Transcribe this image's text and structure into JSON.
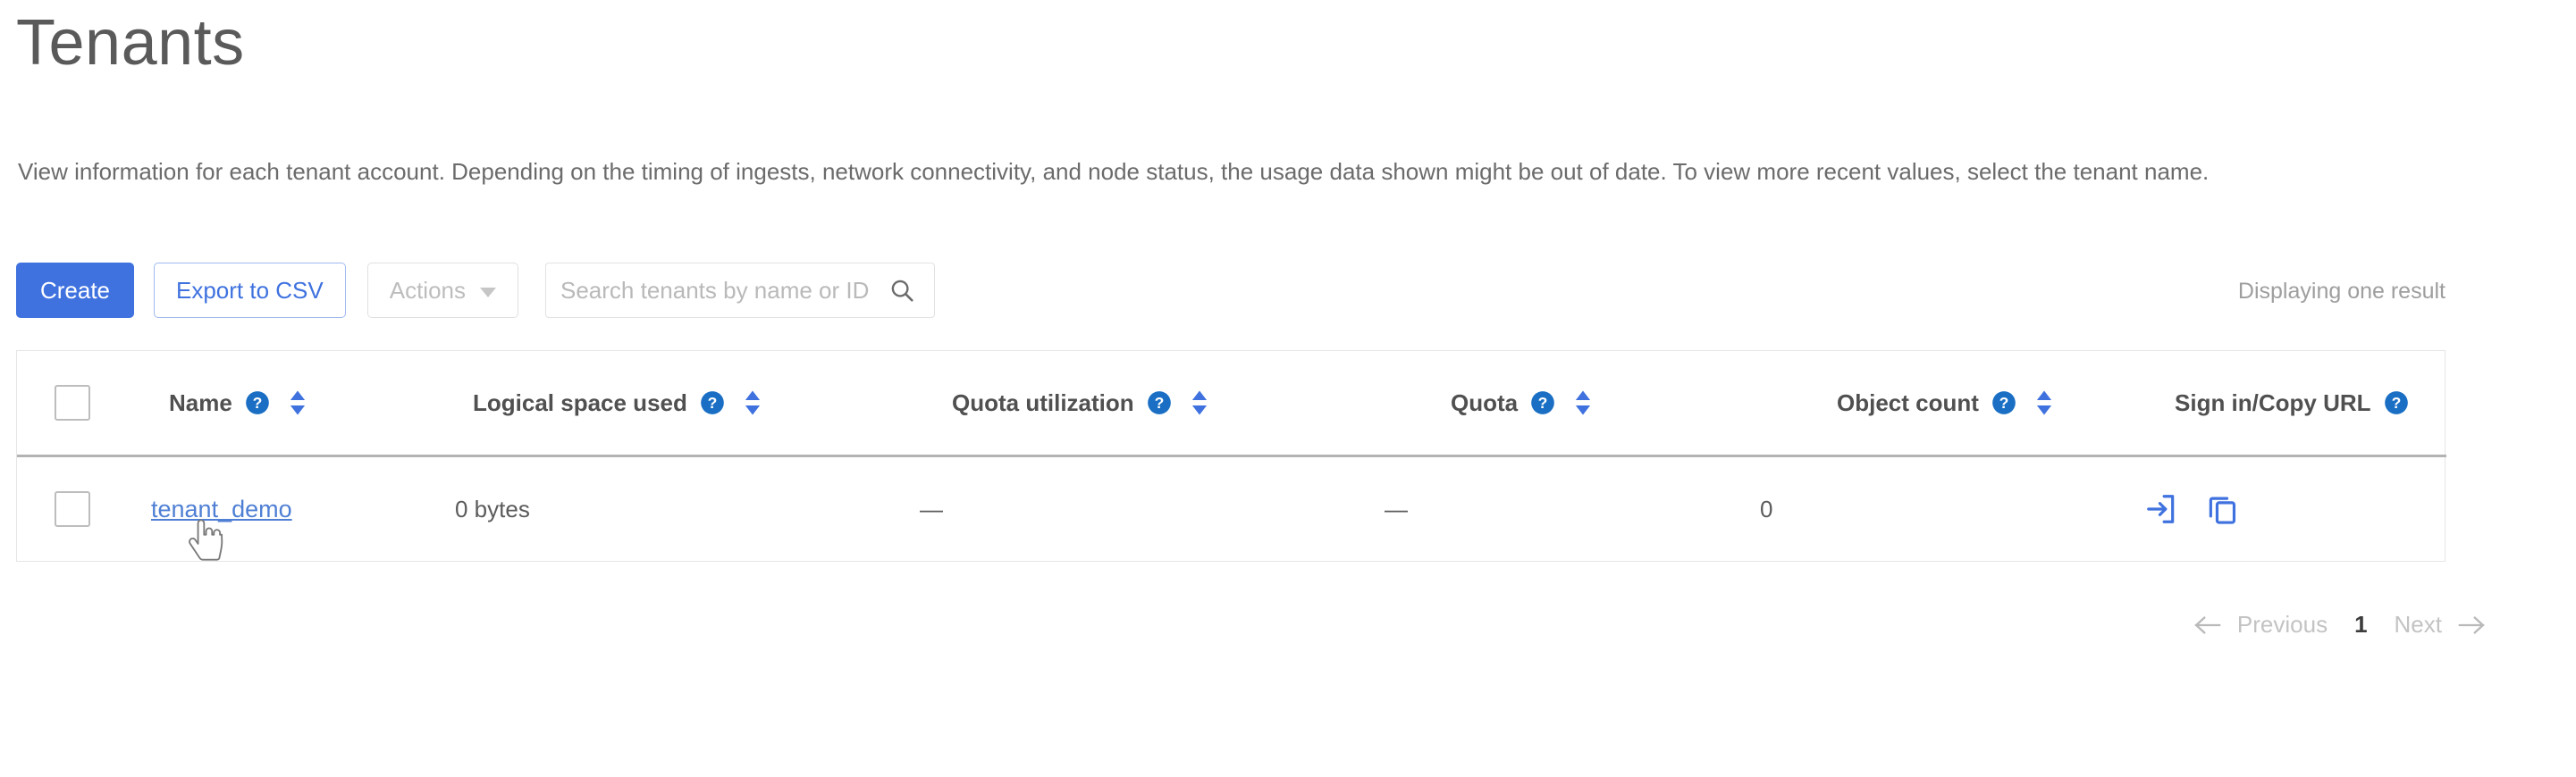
{
  "page": {
    "title": "Tenants",
    "description": "View information for each tenant account. Depending on the timing of ingests, network connectivity, and node status, the usage data shown might be out of date. To view more recent values, select the tenant name."
  },
  "toolbar": {
    "create_label": "Create",
    "export_label": "Export to CSV",
    "actions_label": "Actions",
    "search_placeholder": "Search tenants by name or ID",
    "search_value": "",
    "result_count": "Displaying one result"
  },
  "table": {
    "columns": [
      {
        "key": "select",
        "label": "",
        "help": false,
        "sortable": false
      },
      {
        "key": "name",
        "label": "Name",
        "help": true,
        "sortable": true
      },
      {
        "key": "logical",
        "label": "Logical space used",
        "help": true,
        "sortable": true
      },
      {
        "key": "quotautil",
        "label": "Quota utilization",
        "help": true,
        "sortable": true
      },
      {
        "key": "quota",
        "label": "Quota",
        "help": true,
        "sortable": true
      },
      {
        "key": "objects",
        "label": "Object count",
        "help": true,
        "sortable": true
      },
      {
        "key": "signin",
        "label": "Sign in/Copy URL",
        "help": true,
        "sortable": false
      }
    ],
    "rows": [
      {
        "name": "tenant_demo",
        "logical_space_used": "0 bytes",
        "quota_utilization": "—",
        "quota": "—",
        "object_count": "0",
        "selected": false,
        "sign_in_icon": "sign-in-icon",
        "copy_url_icon": "copy-url-icon"
      }
    ]
  },
  "pagination": {
    "previous_label": "Previous",
    "current_page": "1",
    "next_label": "Next"
  },
  "icons": {
    "help": "help-circle-icon",
    "sort": "sort-arrows-icon",
    "search": "search-icon",
    "caret": "chevron-down-icon",
    "prev_arrow": "arrow-left-icon",
    "next_arrow": "arrow-right-icon"
  },
  "colors": {
    "primary": "#3f72df",
    "link": "#4f7fd4",
    "help_blue": "#1a6fc4",
    "muted": "#9e9e9e",
    "border": "#e6e6e6"
  }
}
